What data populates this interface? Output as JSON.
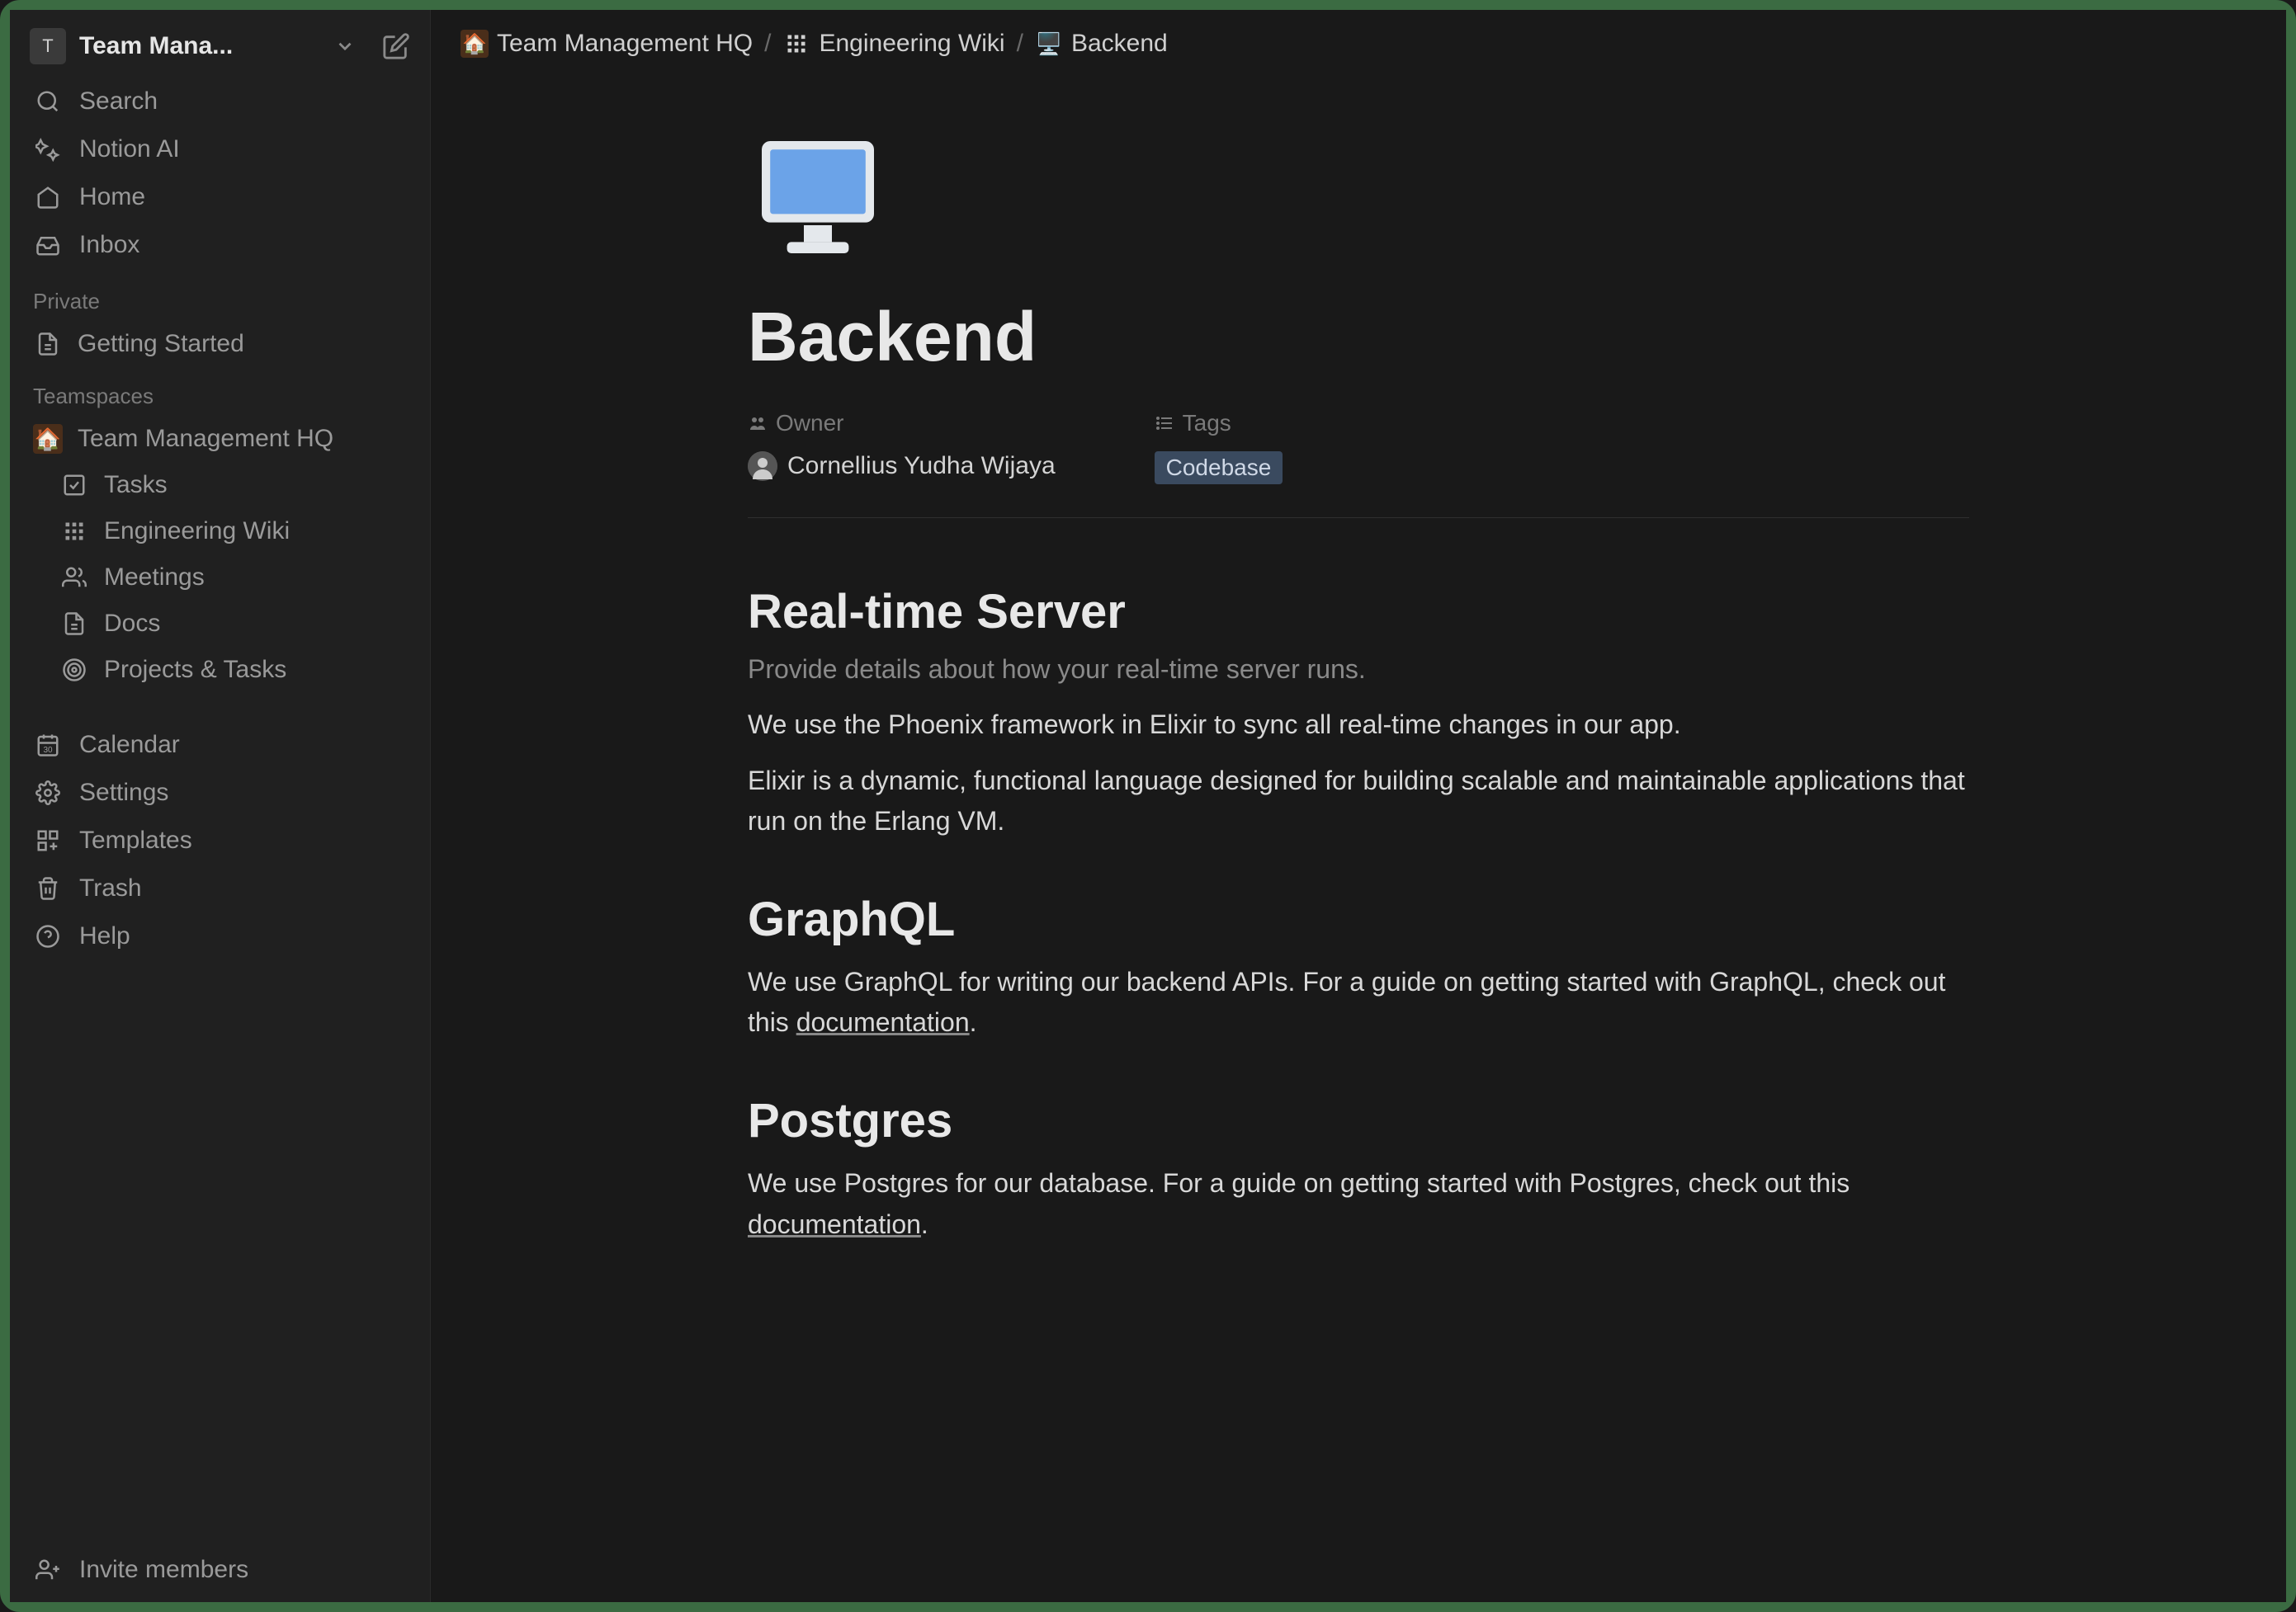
{
  "workspace": {
    "badge_letter": "T",
    "name": "Team Mana..."
  },
  "sidebar": {
    "top": [
      {
        "icon": "search-icon",
        "label": "Search"
      },
      {
        "icon": "ai-icon",
        "label": "Notion AI"
      },
      {
        "icon": "home-icon",
        "label": "Home"
      },
      {
        "icon": "inbox-icon",
        "label": "Inbox"
      }
    ],
    "sections": {
      "private_label": "Private",
      "private_items": [
        {
          "icon": "page-icon",
          "label": "Getting Started"
        }
      ],
      "teamspaces_label": "Teamspaces",
      "teamspace_name": "Team Management HQ",
      "teamspace_children": [
        {
          "icon": "checkbox-icon",
          "label": "Tasks"
        },
        {
          "icon": "grid-icon",
          "label": "Engineering Wiki"
        },
        {
          "icon": "users-icon",
          "label": "Meetings"
        },
        {
          "icon": "page-icon",
          "label": "Docs"
        },
        {
          "icon": "target-icon",
          "label": "Projects & Tasks"
        }
      ]
    },
    "bottom": [
      {
        "icon": "calendar-icon",
        "label": "Calendar"
      },
      {
        "icon": "settings-icon",
        "label": "Settings"
      },
      {
        "icon": "templates-icon",
        "label": "Templates"
      },
      {
        "icon": "trash-icon",
        "label": "Trash"
      },
      {
        "icon": "help-icon",
        "label": "Help"
      }
    ],
    "footer": {
      "icon": "invite-icon",
      "label": "Invite members"
    }
  },
  "breadcrumb": [
    {
      "icon": "house",
      "label": "Team Management HQ"
    },
    {
      "icon": "grid",
      "label": "Engineering Wiki"
    },
    {
      "icon": "computer",
      "label": "Backend"
    }
  ],
  "page": {
    "title": "Backend",
    "props": {
      "owner_label": "Owner",
      "owner_value": "Cornellius Yudha Wijaya",
      "tags_label": "Tags",
      "tags_value": "Codebase"
    },
    "sections": [
      {
        "heading": "Real-time Server",
        "sub": "Provide details about how your real-time server runs.",
        "paragraphs": [
          "We use the Phoenix framework in Elixir to sync all real-time changes in our app.",
          "Elixir is a dynamic, functional language designed for building scalable and maintainable applications that run on the Erlang VM."
        ]
      },
      {
        "heading": "GraphQL",
        "paragraphs_parts": [
          {
            "pre": "We use GraphQL for writing our backend APIs. For a guide on getting started with GraphQL, check out this ",
            "link": "documentation",
            "post": "."
          }
        ]
      },
      {
        "heading": "Postgres",
        "paragraphs_parts": [
          {
            "pre": "We use Postgres for our database. For a guide on getting started with Postgres, check out this ",
            "link": "documentation",
            "post": "."
          }
        ]
      }
    ]
  }
}
